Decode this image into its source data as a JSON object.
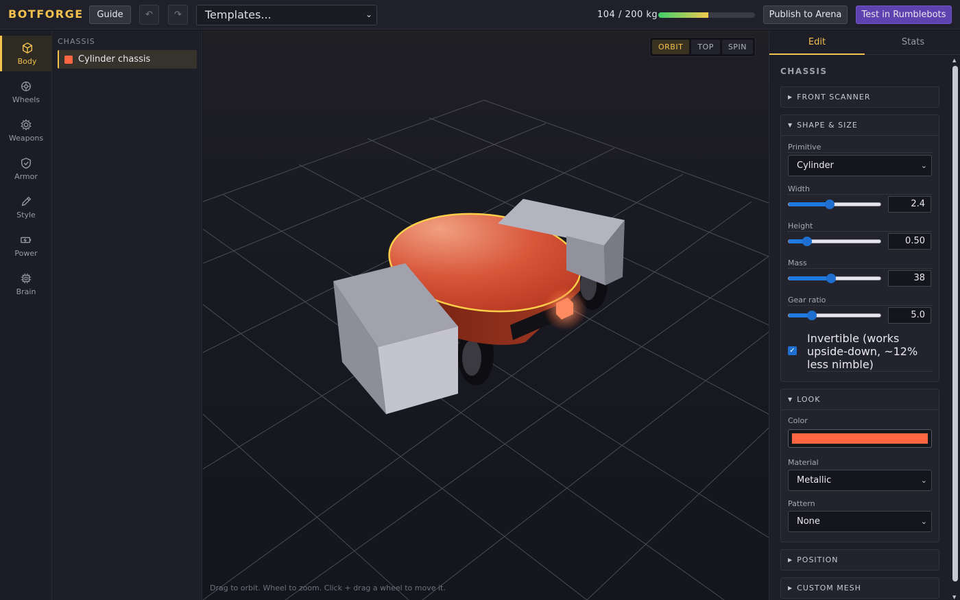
{
  "app": {
    "logo": "BOTFORGE",
    "guide_label": "Guide",
    "undo_label": "↶",
    "redo_label": "↷",
    "templates_label": "Templates...",
    "mass_text": "104 / 200 kg",
    "mass_fraction": 0.52,
    "publish_label": "Publish to Arena",
    "test_label": "Test in Rumblebots"
  },
  "rail": {
    "items": [
      {
        "label": "Body",
        "icon": "cube-icon"
      },
      {
        "label": "Wheels",
        "icon": "wheel-icon"
      },
      {
        "label": "Weapons",
        "icon": "gear-icon"
      },
      {
        "label": "Armor",
        "icon": "shield-icon"
      },
      {
        "label": "Style",
        "icon": "brush-icon"
      },
      {
        "label": "Power",
        "icon": "battery-icon"
      },
      {
        "label": "Brain",
        "icon": "chip-icon"
      }
    ],
    "active": "Body"
  },
  "tree": {
    "heading": "CHASSIS",
    "item_label": "Cylinder chassis",
    "item_color": "#ff6644"
  },
  "viewport": {
    "modes": [
      "ORBIT",
      "TOP",
      "SPIN"
    ],
    "active_mode": "ORBIT",
    "hint": "Drag to orbit. Wheel to zoom. Click + drag a wheel to move it."
  },
  "panel": {
    "tabs": [
      "Edit",
      "Stats"
    ],
    "active_tab": "Edit",
    "section_title": "CHASSIS",
    "front_scanner": "FRONT SCANNER",
    "shape_size": {
      "title": "SHAPE & SIZE",
      "primitive_label": "Primitive",
      "primitive_value": "Cylinder",
      "width_label": "Width",
      "width_value": "2.4",
      "width_fraction": 0.45,
      "height_label": "Height",
      "height_value": "0.50",
      "height_fraction": 0.2,
      "mass_label": "Mass",
      "mass_value": "38",
      "mass_fraction": 0.46,
      "gear_label": "Gear ratio",
      "gear_value": "5.0",
      "gear_fraction": 0.25,
      "invertible_label": "Invertible (works upside-down, ~12% less nimble)",
      "invertible_checked": true
    },
    "look": {
      "title": "LOOK",
      "color_label": "Color",
      "color_value": "#ff6644",
      "material_label": "Material",
      "material_value": "Metallic",
      "pattern_label": "Pattern",
      "pattern_value": "None"
    },
    "position": "POSITION",
    "custom_mesh": "CUSTOM MESH"
  },
  "colors": {
    "accent": "#f2c14e",
    "test_button": "#5d42b0",
    "chassis": "#ff6644"
  }
}
